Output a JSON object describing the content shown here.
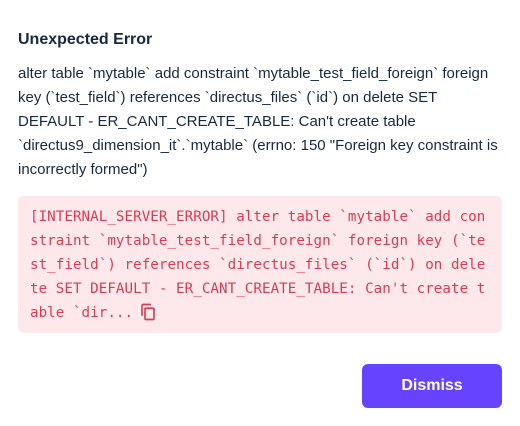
{
  "dialog": {
    "title": "Unexpected Error",
    "message": "alter table `mytable` add constraint `mytable_test_field_foreign` foreign key (`test_field`) references `directus_files` (`id`) on delete SET DEFAULT - ER_CANT_CREATE_TABLE: Can't create table `directus9_dimension_it`.`mytable` (errno: 150 \"Foreign key constraint is incorrectly formed\")",
    "error_detail": "[INTERNAL_SERVER_ERROR] alter table `mytable` add constraint `mytable_test_field_foreign` foreign key (`test_field`) references `directus_files` (`id`) on delete SET DEFAULT - ER_CANT_CREATE_TABLE: Can't create table `dir...",
    "copy_icon": "copy-icon",
    "dismiss_label": "Dismiss"
  },
  "colors": {
    "text": "#172940",
    "error_bg": "#fde9ec",
    "error_text": "#e0394f",
    "primary": "#6644ff"
  }
}
